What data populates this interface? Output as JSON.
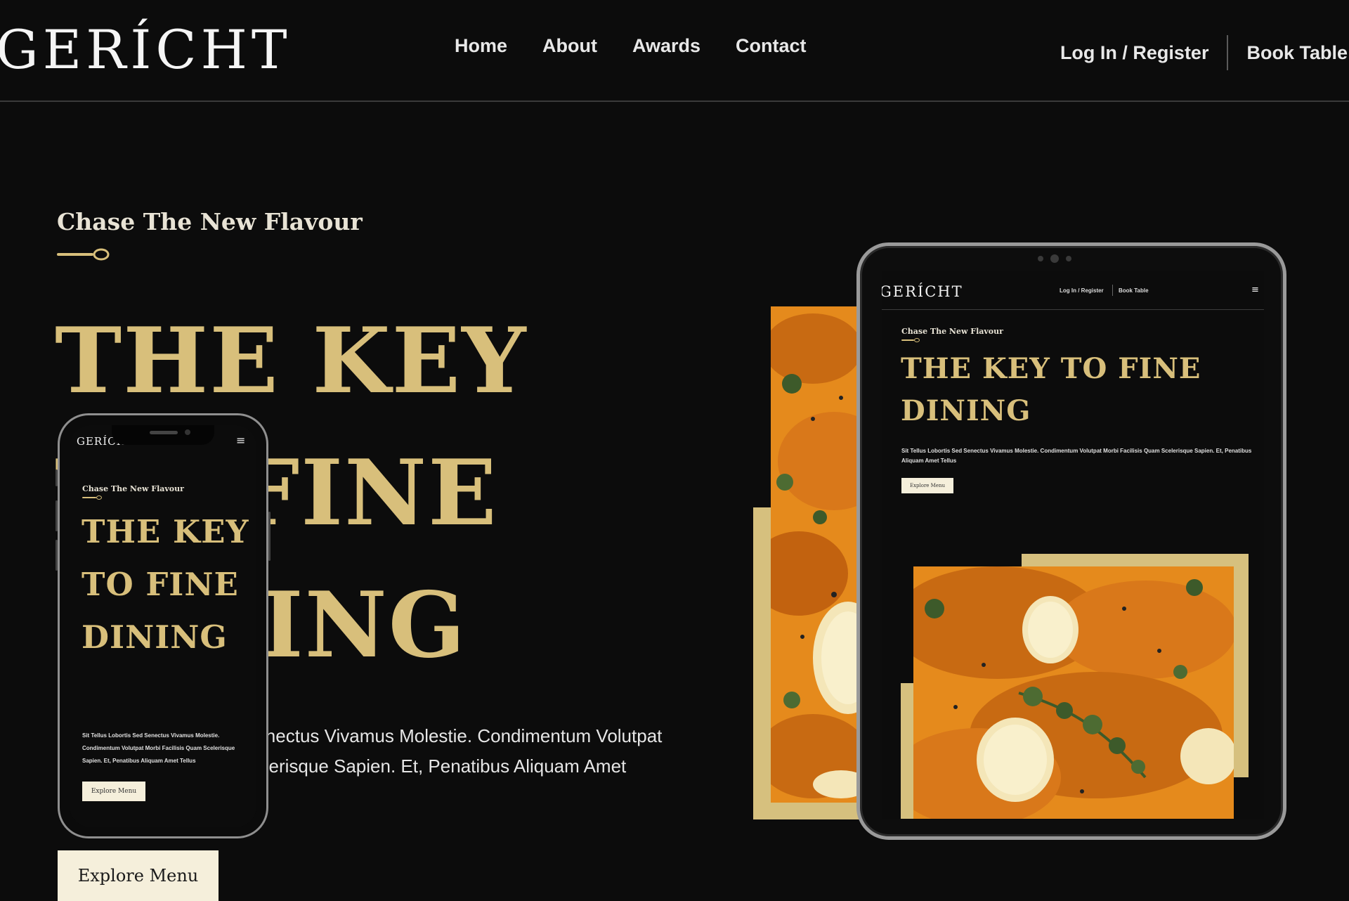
{
  "site": {
    "logo": "GERÍCHT",
    "nav": [
      {
        "label": "Home"
      },
      {
        "label": "About"
      },
      {
        "label": "Awards"
      },
      {
        "label": "Contact"
      }
    ],
    "login_label": "Log In / Register",
    "book_label": "Book Table"
  },
  "hero": {
    "subtitle": "Chase The New Flavour",
    "title": "THE KEY TO FINE DINING",
    "paragraph": "Sit Tellus Lobortis Sed Senectus Vivamus Molestie. Condimentum Volutpat Morbi Facilisis Quam Scelerisque Sapien. Et, Penatibus Aliquam Amet Tellus",
    "button_label": "Explore Menu"
  },
  "tablet": {
    "logo": "GERÍCHT",
    "login_label": "Log In / Register",
    "book_label": "Book Table",
    "menu_icon": "≡",
    "subtitle": "Chase The New Flavour",
    "title": "THE KEY TO FINE DINING",
    "paragraph": "Sit Tellus Lobortis Sed Senectus Vivamus Molestie. Condimentum Volutpat Morbi Facilisis Quam Scelerisque Sapien. Et, Penatibus Aliquam Amet Tellus",
    "button_label": "Explore Menu"
  },
  "phone": {
    "logo": "GERÍCHT",
    "menu_icon": "≡",
    "subtitle": "Chase The New Flavour",
    "title": "THE KEY TO FINE DINING",
    "paragraph": "Sit Tellus Lobortis Sed Senectus Vivamus Molestie. Condimentum Volutpat Morbi Facilisis Quam Scelerisque Sapien. Et, Penatibus Aliquam Amet Tellus",
    "button_label": "Explore Menu"
  },
  "colors": {
    "background": "#0c0c0c",
    "gold": "#d8bf7b",
    "cream": "#f5efdb"
  },
  "icons": [
    "spoon-divider-icon",
    "hamburger-menu-icon",
    "camera-icon"
  ]
}
